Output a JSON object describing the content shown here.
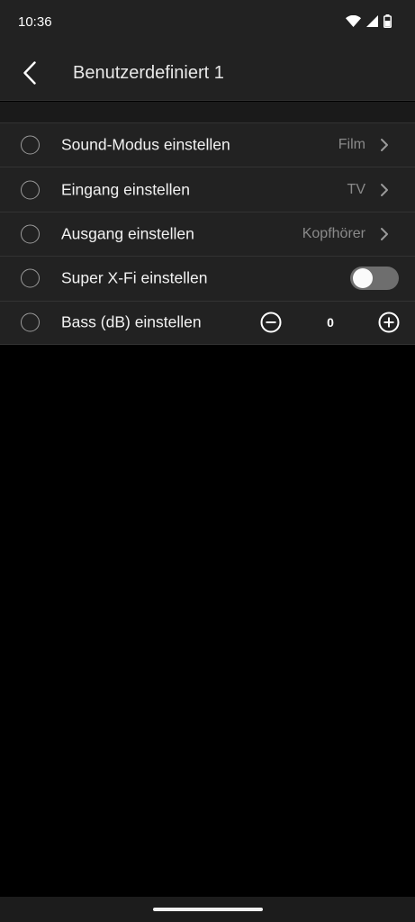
{
  "status_bar": {
    "time": "10:36",
    "icons": [
      "wifi-icon",
      "cell-signal-icon",
      "battery-icon"
    ]
  },
  "app_bar": {
    "title": "Benutzerdefiniert 1",
    "back_icon": "chevron-left-icon"
  },
  "settings": [
    {
      "label": "Sound-Modus einstellen",
      "value": "Film",
      "control": "chevron"
    },
    {
      "label": "Eingang einstellen",
      "value": "TV",
      "control": "chevron"
    },
    {
      "label": "Ausgang einstellen",
      "value": "Kopfhörer",
      "control": "chevron"
    },
    {
      "label": "Super X-Fi einstellen",
      "control": "toggle",
      "toggle_on": false
    },
    {
      "label": "Bass (dB) einstellen",
      "control": "stepper",
      "stepper_value": "0"
    }
  ],
  "colors": {
    "background": "#000000",
    "surface": "#222222",
    "divider": "#333333",
    "secondary_text": "#8a8a8a",
    "toggle_track_off": "#6e6e6e"
  }
}
